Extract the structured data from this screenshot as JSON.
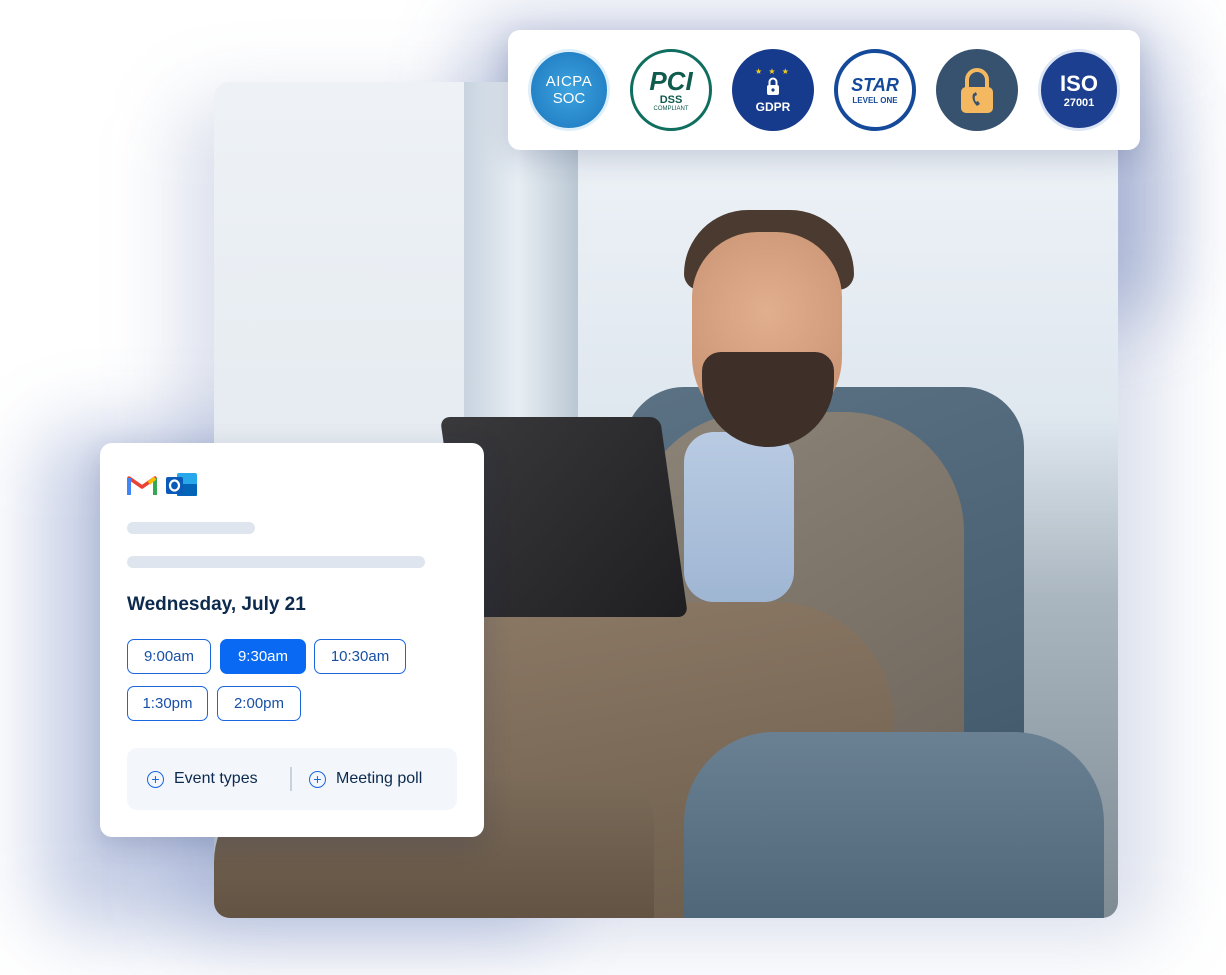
{
  "certifications": {
    "aicpa": {
      "line1": "AICPA",
      "line2": "SOC"
    },
    "pci": {
      "line1": "PCI",
      "line2": "DSS",
      "line3": "COMPLIANT"
    },
    "gdpr": {
      "label": "GDPR"
    },
    "star": {
      "line1": "STAR",
      "line2": "LEVEL ONE"
    },
    "iso": {
      "line1": "ISO",
      "line2": "27001"
    }
  },
  "scheduler": {
    "date": "Wednesday, July 21",
    "slots": [
      "9:00am",
      "9:30am",
      "10:30am",
      "1:30pm",
      "2:00pm"
    ],
    "selected_slot": "9:30am",
    "actions": {
      "event_types": "Event types",
      "meeting_poll": "Meeting poll"
    }
  },
  "colors": {
    "accent": "#0a69f2",
    "heading": "#0c2a4d",
    "skeleton": "#dfe5ee"
  },
  "icons": [
    "gmail-icon",
    "outlook-icon",
    "lock-icon",
    "plus-circle-icon"
  ]
}
